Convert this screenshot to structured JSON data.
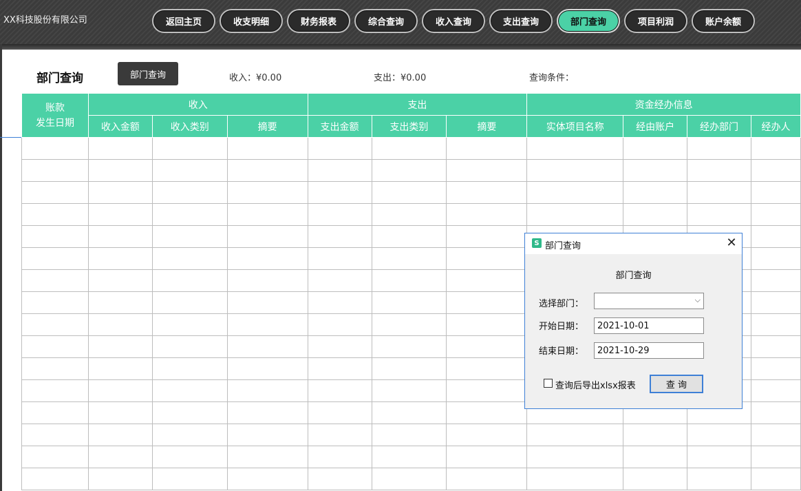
{
  "app": {
    "company": "XX科技股份有限公司"
  },
  "nav": {
    "items": [
      {
        "label": "返回主页",
        "active": false
      },
      {
        "label": "收支明细",
        "active": false
      },
      {
        "label": "财务报表",
        "active": false
      },
      {
        "label": "综合查询",
        "active": false
      },
      {
        "label": "收入查询",
        "active": false
      },
      {
        "label": "支出查询",
        "active": false
      },
      {
        "label": "部门查询",
        "active": true
      },
      {
        "label": "项目利润",
        "active": false
      },
      {
        "label": "账户余额",
        "active": false
      }
    ]
  },
  "header": {
    "title": "部门查询",
    "query_button": "部门查询",
    "income": "收入：¥0.00",
    "expense": "支出：¥0.00",
    "conditions": "查询条件："
  },
  "table": {
    "date_col": "账款\n发生日期",
    "groups": [
      "收入",
      "支出",
      "资金经办信息"
    ],
    "columns": [
      "收入金额",
      "收入类别",
      "摘要",
      "支出金额",
      "支出类别",
      "摘要",
      "实体项目名称",
      "经由账户",
      "经办部门",
      "经办人"
    ]
  },
  "dialog": {
    "title": "部门查询",
    "heading": "部门查询",
    "dept_label": "选择部门：",
    "dept_value": "",
    "start_label": "开始日期：",
    "start_value": "2021-10-01",
    "end_label": "结束日期：",
    "end_value": "2021-10-29",
    "export_label": "查询后导出xlsx报表",
    "export_checked": false,
    "query_button": "查 询"
  },
  "colors": {
    "accent": "#4bd1a6",
    "topbar": "#3b3b3b",
    "focus": "#3d7fd6"
  }
}
